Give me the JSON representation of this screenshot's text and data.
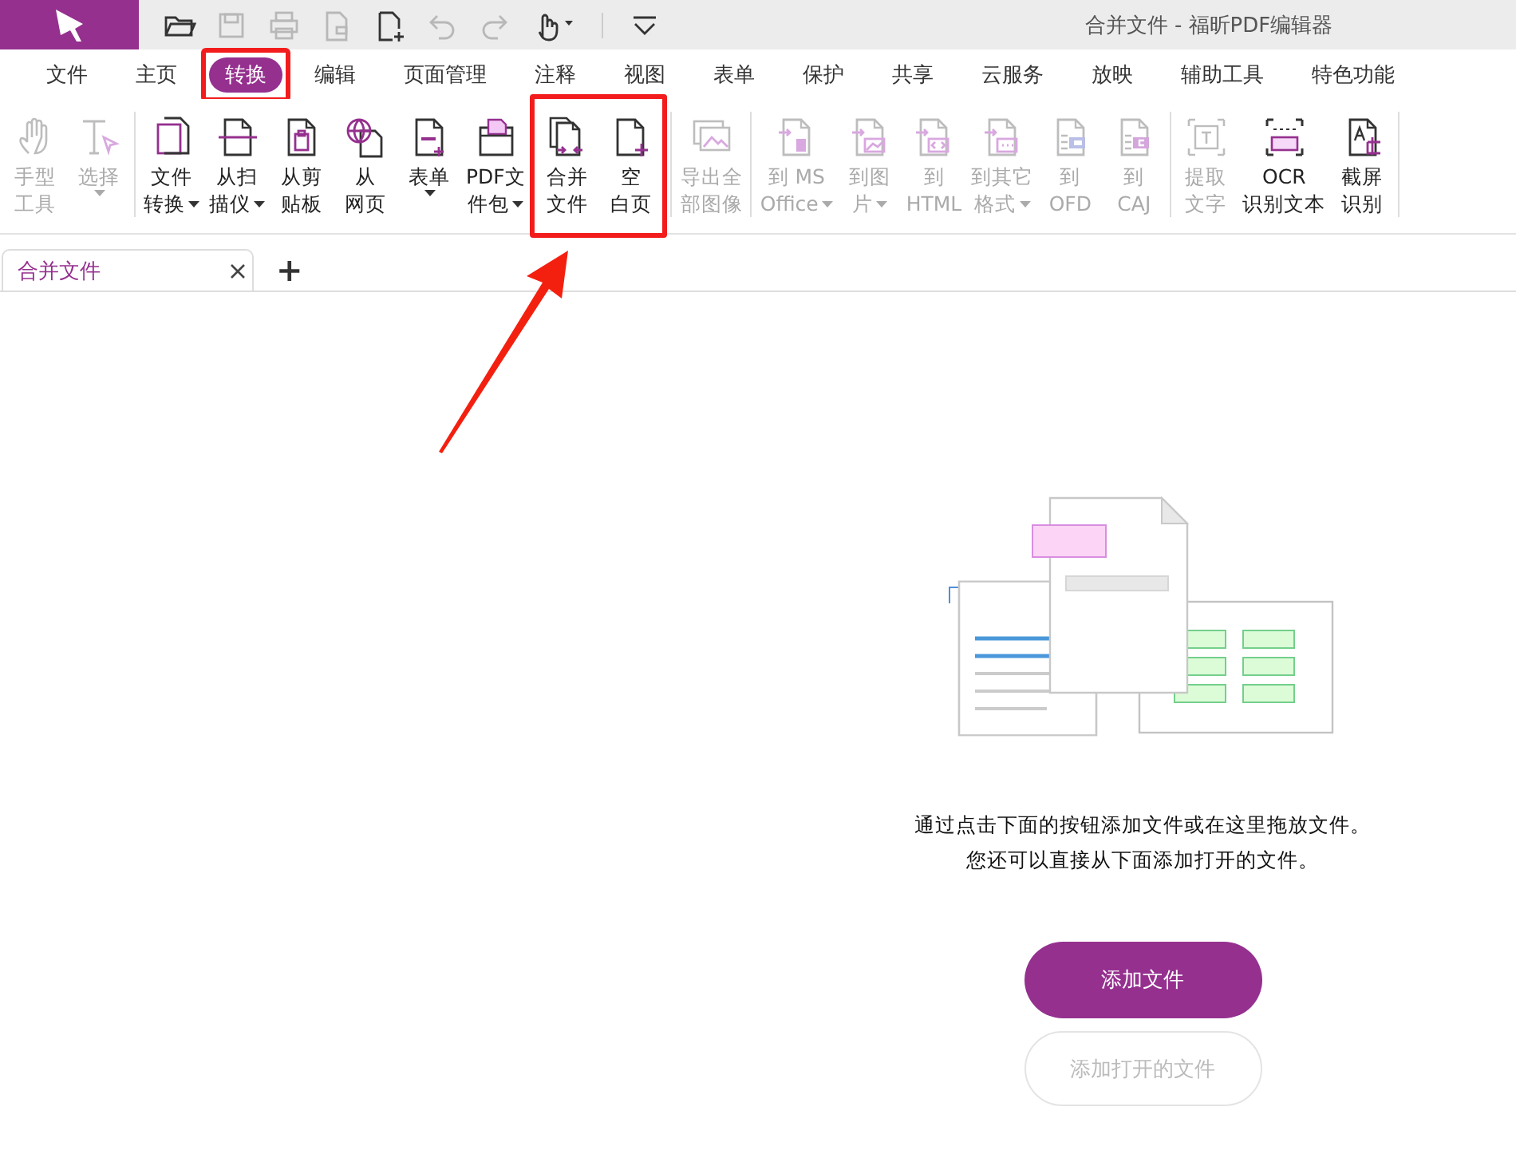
{
  "app": {
    "title": "合并文件 - 福昕PDF编辑器"
  },
  "quick_toolbar": [
    {
      "kind": "open",
      "disabled": false
    },
    {
      "kind": "save",
      "disabled": true
    },
    {
      "kind": "print",
      "disabled": true
    },
    {
      "kind": "export",
      "disabled": true
    },
    {
      "kind": "new",
      "disabled": false
    },
    {
      "kind": "undo",
      "disabled": true
    },
    {
      "kind": "redo",
      "disabled": true
    },
    {
      "kind": "hand",
      "disabled": false
    },
    {
      "kind": "customize",
      "disabled": false
    }
  ],
  "menu_tabs": [
    {
      "label": "文件",
      "selected": false,
      "highlighted": false
    },
    {
      "label": "主页",
      "selected": false,
      "highlighted": false
    },
    {
      "label": "转换",
      "selected": true,
      "highlighted": true
    },
    {
      "label": "编辑",
      "selected": false,
      "highlighted": false
    },
    {
      "label": "页面管理",
      "selected": false,
      "highlighted": false
    },
    {
      "label": "注释",
      "selected": false,
      "highlighted": false
    },
    {
      "label": "视图",
      "selected": false,
      "highlighted": false
    },
    {
      "label": "表单",
      "selected": false,
      "highlighted": false
    },
    {
      "label": "保护",
      "selected": false,
      "highlighted": false
    },
    {
      "label": "共享",
      "selected": false,
      "highlighted": false
    },
    {
      "label": "云服务",
      "selected": false,
      "highlighted": false
    },
    {
      "label": "放映",
      "selected": false,
      "highlighted": false
    },
    {
      "label": "辅助工具",
      "selected": false,
      "highlighted": false
    },
    {
      "label": "特色功能",
      "selected": false,
      "highlighted": false
    }
  ],
  "ribbon": {
    "groups": [
      {
        "items": [
          {
            "kind": "hand",
            "lines": [
              "手型",
              "工具"
            ],
            "disabled": true,
            "dropdown": false,
            "highlighted": false
          },
          {
            "kind": "select",
            "lines": [
              "选择"
            ],
            "disabled": true,
            "dropdown": true,
            "highlighted": false
          }
        ]
      },
      {
        "items": [
          {
            "kind": "file",
            "lines": [
              "文件",
              "转换"
            ],
            "disabled": false,
            "dropdown": true,
            "highlighted": false
          },
          {
            "kind": "scan",
            "lines": [
              "从扫",
              "描仪"
            ],
            "disabled": false,
            "dropdown": true,
            "highlighted": false
          },
          {
            "kind": "clipboard",
            "lines": [
              "从剪",
              "贴板"
            ],
            "disabled": false,
            "dropdown": false,
            "highlighted": false
          },
          {
            "kind": "web",
            "lines": [
              "从",
              "网页"
            ],
            "disabled": false,
            "dropdown": false,
            "highlighted": false
          },
          {
            "kind": "form",
            "lines": [
              "表单"
            ],
            "disabled": false,
            "dropdown": true,
            "highlighted": false
          },
          {
            "kind": "package",
            "lines": [
              "PDF文",
              "件包"
            ],
            "disabled": false,
            "dropdown": true,
            "highlighted": false
          },
          {
            "kind": "merge",
            "lines": [
              "合并",
              "文件"
            ],
            "disabled": false,
            "dropdown": false,
            "highlighted": true
          },
          {
            "kind": "blank",
            "lines": [
              "空",
              "白页"
            ],
            "disabled": false,
            "dropdown": false,
            "highlighted": true
          }
        ]
      },
      {
        "items": [
          {
            "kind": "image",
            "lines": [
              "导出全",
              "部图像"
            ],
            "disabled": true,
            "dropdown": false,
            "highlighted": false
          }
        ]
      },
      {
        "items": [
          {
            "kind": "office",
            "lines": [
              "到 MS",
              "Office"
            ],
            "disabled": true,
            "dropdown": true,
            "highlighted": false
          },
          {
            "kind": "picture",
            "lines": [
              "到图",
              "片"
            ],
            "disabled": true,
            "dropdown": true,
            "highlighted": false
          },
          {
            "kind": "html",
            "lines": [
              "到",
              "HTML"
            ],
            "disabled": true,
            "dropdown": false,
            "highlighted": false
          },
          {
            "kind": "other",
            "lines": [
              "到其它",
              "格式"
            ],
            "disabled": true,
            "dropdown": true,
            "highlighted": false
          },
          {
            "kind": "ofd",
            "lines": [
              "到",
              "OFD"
            ],
            "disabled": true,
            "dropdown": false,
            "highlighted": false
          },
          {
            "kind": "caj",
            "lines": [
              "到",
              "CAJ"
            ],
            "disabled": true,
            "dropdown": false,
            "highlighted": false
          }
        ]
      },
      {
        "items": [
          {
            "kind": "text",
            "lines": [
              "提取",
              "文字"
            ],
            "disabled": true,
            "dropdown": false,
            "highlighted": false
          },
          {
            "kind": "ocr",
            "lines": [
              "OCR",
              "识别文本"
            ],
            "disabled": false,
            "dropdown": false,
            "highlighted": false
          },
          {
            "kind": "screen",
            "lines": [
              "截屏",
              "识别"
            ],
            "disabled": false,
            "dropdown": false,
            "highlighted": false
          }
        ]
      }
    ]
  },
  "document_tabs": [
    {
      "label": "合并文件",
      "selected": true
    }
  ],
  "new_tab_button": "+",
  "start_panel": {
    "message_lines": [
      "通过点击下面的按钮添加文件或在这里拖放文件。",
      "您还可以直接从下面添加打开的文件。"
    ],
    "buttons": [
      {
        "label": "添加文件",
        "kind": "primary",
        "disabled": false
      },
      {
        "label": "添加打开的文件",
        "kind": "secondary",
        "disabled": true
      }
    ]
  }
}
